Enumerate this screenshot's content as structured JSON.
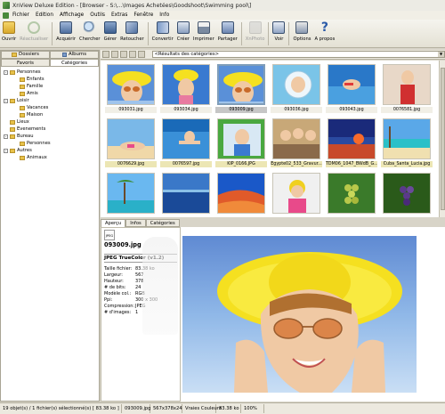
{
  "window": {
    "title": "XnView Deluxe Edition - [Browser - S:\\...\\Images Achetées\\Goodshoot\\Swimming pool\\]"
  },
  "menu": [
    "Fichier",
    "Edition",
    "Affichage",
    "Outils",
    "Extras",
    "Fenêtre",
    "Info"
  ],
  "toolbar": {
    "items": [
      {
        "label": "Ouvrir",
        "icon": "folder-open-icon",
        "enabled": true
      },
      {
        "label": "Réactualiser",
        "icon": "refresh-icon",
        "enabled": false
      },
      {
        "label": "Acquérir",
        "icon": "scanner-icon",
        "enabled": true
      },
      {
        "label": "Chercher",
        "icon": "search-icon",
        "enabled": true
      },
      {
        "label": "Gérer",
        "icon": "manage-icon",
        "enabled": true
      },
      {
        "label": "Retoucher",
        "icon": "edit-icon",
        "enabled": true
      },
      {
        "label": "Convertir",
        "icon": "convert-icon",
        "enabled": true
      },
      {
        "label": "Créer",
        "icon": "create-icon",
        "enabled": true
      },
      {
        "label": "Imprimer",
        "icon": "printer-icon",
        "enabled": true
      },
      {
        "label": "Partager",
        "icon": "share-icon",
        "enabled": true
      },
      {
        "label": "XnPhoto",
        "icon": "xnphoto-icon",
        "enabled": false
      },
      {
        "label": "Voir",
        "icon": "view-icon",
        "enabled": true
      },
      {
        "label": "Options",
        "icon": "options-icon",
        "enabled": true
      },
      {
        "label": "A propos",
        "icon": "help-icon",
        "enabled": true
      }
    ]
  },
  "left_panel": {
    "tabs": [
      "Dossiers",
      "Albums"
    ],
    "subtabs": [
      "Favoris",
      "Catégories"
    ],
    "active_subtab": "Catégories",
    "tree": [
      {
        "label": "Personnes",
        "level": 0,
        "expand": "-"
      },
      {
        "label": "Enfants",
        "level": 1
      },
      {
        "label": "Famille",
        "level": 1
      },
      {
        "label": "Amis",
        "level": 1
      },
      {
        "label": "Loisir",
        "level": 0,
        "expand": "-"
      },
      {
        "label": "Vacances",
        "level": 1
      },
      {
        "label": "Maison",
        "level": 1
      },
      {
        "label": "Lieux",
        "level": 0
      },
      {
        "label": "Evenements",
        "level": 0
      },
      {
        "label": "Bureau",
        "level": 0,
        "expand": "-"
      },
      {
        "label": "Personnes",
        "level": 1
      },
      {
        "label": "Autres",
        "level": 0,
        "expand": "-"
      },
      {
        "label": "Animaux",
        "level": 1
      }
    ]
  },
  "pathbar": {
    "value": "<Résultats des catégories>"
  },
  "thumbnails": [
    {
      "name": "093031.jpg",
      "scene": "hat-woman",
      "state": "normal"
    },
    {
      "name": "093034.jpg",
      "scene": "hat-woman-blue",
      "state": "normal"
    },
    {
      "name": "093009.jpg",
      "scene": "hat-woman",
      "state": "selected"
    },
    {
      "name": "093036.jpg",
      "scene": "bubble",
      "state": "normal"
    },
    {
      "name": "093043.jpg",
      "scene": "swimmer",
      "state": "normal"
    },
    {
      "name": "0076581.jpg",
      "scene": "woman-red",
      "state": "normal"
    },
    {
      "name": "0076629.jpg",
      "scene": "beach-woman",
      "state": "highlight"
    },
    {
      "name": "0076597.jpg",
      "scene": "pool-woman",
      "state": "highlight"
    },
    {
      "name": "KIP_0166.JPG",
      "scene": "frame-green",
      "state": "highlight"
    },
    {
      "name": "Egypte02_533_Gravur...",
      "scene": "group",
      "state": "highlight"
    },
    {
      "name": "TDM06_1047_BWdB_G...",
      "scene": "sunset",
      "state": "highlight"
    },
    {
      "name": "Cuba_Santa_Lucia.jpg",
      "scene": "beach",
      "state": "highlight"
    },
    {
      "name": "",
      "scene": "palm",
      "state": "normal"
    },
    {
      "name": "",
      "scene": "sea",
      "state": "normal"
    },
    {
      "name": "",
      "scene": "desert",
      "state": "normal"
    },
    {
      "name": "",
      "scene": "kid",
      "state": "normal"
    },
    {
      "name": "",
      "scene": "grapes",
      "state": "normal"
    },
    {
      "name": "",
      "scene": "grapes-dark",
      "state": "normal"
    }
  ],
  "bottom_tabs": [
    "Aperçu",
    "Infos",
    "Catégories"
  ],
  "info": {
    "file_icon": "JPEG",
    "filename": "093009.jpg",
    "type": "JPEG TrueColor (v1.2)",
    "rows": [
      {
        "k": "Taille fichier:",
        "v": "83.38 ko"
      },
      {
        "k": "Largeur:",
        "v": "567"
      },
      {
        "k": "Hauteur:",
        "v": "378"
      },
      {
        "k": "# de bits:",
        "v": "24"
      },
      {
        "k": "Modèle col.:",
        "v": "RGB"
      },
      {
        "k": "Ppi:",
        "v": "300 x 300"
      },
      {
        "k": "Compression:",
        "v": "JPEG"
      },
      {
        "k": "# d'images:",
        "v": "1"
      }
    ]
  },
  "statusbar": [
    "19 objet(s) / 1 fichier(s) sélectionné(s) [ 83.38 ko ]",
    "093009.jpg",
    "567x378x24",
    "Vraies Couleurs",
    "83.38 ko",
    "100%"
  ]
}
